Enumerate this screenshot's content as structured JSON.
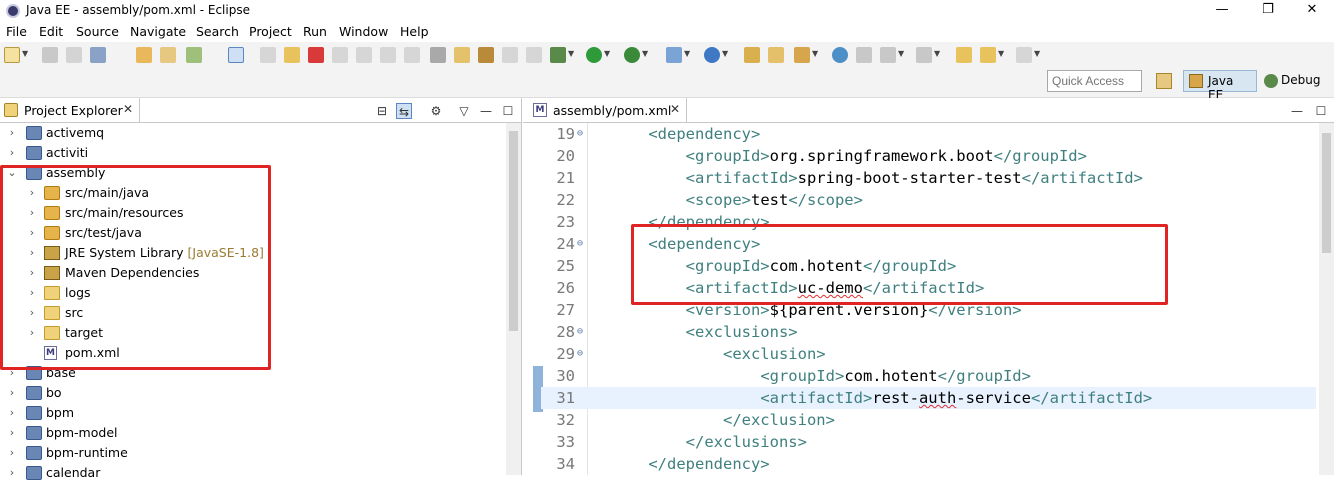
{
  "window": {
    "title": "Java EE - assembly/pom.xml - Eclipse",
    "minimize": "—",
    "restore": "❐",
    "close": "✕"
  },
  "menu": [
    "File",
    "Edit",
    "Source",
    "Navigate",
    "Search",
    "Project",
    "Run",
    "Window",
    "Help"
  ],
  "toolbar": {
    "quick_access_placeholder": "Quick Access",
    "perspectives": [
      {
        "label": "Java EE",
        "active": true
      },
      {
        "label": "Debug",
        "active": false
      }
    ]
  },
  "explorer": {
    "tab_label": "Project Explorer",
    "close_glyph": "✕",
    "items": [
      {
        "label": "activemq",
        "expanded": false,
        "icon": "project-icon"
      },
      {
        "label": "activiti",
        "expanded": false,
        "icon": "project-icon"
      },
      {
        "label": "assembly",
        "expanded": true,
        "icon": "project-icon"
      },
      {
        "label": "src/main/java",
        "expanded": false,
        "icon": "package-folder-icon"
      },
      {
        "label": "src/main/resources",
        "expanded": false,
        "icon": "package-folder-icon"
      },
      {
        "label": "src/test/java",
        "expanded": false,
        "icon": "package-folder-icon"
      },
      {
        "label": "JRE System Library",
        "decoration": "[JavaSE-1.8]",
        "expanded": false,
        "icon": "library-icon"
      },
      {
        "label": "Maven Dependencies",
        "expanded": false,
        "icon": "library-icon"
      },
      {
        "label": "logs",
        "expanded": false,
        "icon": "folder-icon"
      },
      {
        "label": "src",
        "expanded": false,
        "icon": "folder-icon"
      },
      {
        "label": "target",
        "expanded": false,
        "icon": "folder-icon"
      },
      {
        "label": "pom.xml",
        "icon": "xml-file-icon"
      },
      {
        "label": "base",
        "expanded": false,
        "icon": "project-icon"
      },
      {
        "label": "bo",
        "expanded": false,
        "icon": "project-icon"
      },
      {
        "label": "bpm",
        "expanded": false,
        "icon": "project-icon"
      },
      {
        "label": "bpm-model",
        "expanded": false,
        "icon": "project-icon"
      },
      {
        "label": "bpm-runtime",
        "expanded": false,
        "icon": "project-icon"
      },
      {
        "label": "calendar",
        "expanded": false,
        "icon": "project-icon"
      }
    ]
  },
  "editor": {
    "tab_label": "assembly/pom.xml",
    "close_glyph": "✕",
    "lines": [
      {
        "num": "19",
        "fold": "⊖",
        "indent": "    ",
        "parts": [
          [
            "tg",
            "<dependency>"
          ]
        ]
      },
      {
        "num": "20",
        "fold": "",
        "indent": "        ",
        "parts": [
          [
            "tg",
            "<groupId>"
          ],
          [
            "tx",
            "org.springframework.boot"
          ],
          [
            "tg",
            "</groupId>"
          ]
        ]
      },
      {
        "num": "21",
        "fold": "",
        "indent": "        ",
        "parts": [
          [
            "tg",
            "<artifactId>"
          ],
          [
            "tx",
            "spring-boot-starter-test"
          ],
          [
            "tg",
            "</artifactId>"
          ]
        ]
      },
      {
        "num": "22",
        "fold": "",
        "indent": "        ",
        "parts": [
          [
            "tg",
            "<scope>"
          ],
          [
            "tx",
            "test"
          ],
          [
            "tg",
            "</scope>"
          ]
        ]
      },
      {
        "num": "23",
        "fold": "",
        "indent": "    ",
        "parts": [
          [
            "tg",
            "</dependency>"
          ]
        ]
      },
      {
        "num": "24",
        "fold": "⊖",
        "indent": "    ",
        "parts": [
          [
            "tg",
            "<dependency>"
          ]
        ]
      },
      {
        "num": "25",
        "fold": "",
        "indent": "        ",
        "parts": [
          [
            "tg",
            "<groupId>"
          ],
          [
            "tx",
            "com.hotent"
          ],
          [
            "tg",
            "</groupId>"
          ]
        ]
      },
      {
        "num": "26",
        "fold": "",
        "indent": "        ",
        "parts": [
          [
            "tg",
            "<artifactId>"
          ],
          [
            "sq",
            "uc-demo"
          ],
          [
            "tg",
            "</artifactId>"
          ]
        ]
      },
      {
        "num": "27",
        "fold": "",
        "indent": "        ",
        "parts": [
          [
            "tg",
            "<version>"
          ],
          [
            "tx",
            "${parent.version}"
          ],
          [
            "tg",
            "</version>"
          ]
        ]
      },
      {
        "num": "28",
        "fold": "⊖",
        "indent": "        ",
        "parts": [
          [
            "tg",
            "<exclusions>"
          ]
        ]
      },
      {
        "num": "29",
        "fold": "⊖",
        "indent": "            ",
        "parts": [
          [
            "tg",
            "<exclusion>"
          ]
        ]
      },
      {
        "num": "30",
        "fold": "",
        "indent": "                ",
        "parts": [
          [
            "tg",
            "<groupId>"
          ],
          [
            "tx",
            "com.hotent"
          ],
          [
            "tg",
            "</groupId>"
          ]
        ]
      },
      {
        "num": "31",
        "fold": "",
        "indent": "                ",
        "current": true,
        "parts": [
          [
            "tg",
            "<artifactId>"
          ],
          [
            "tx",
            "rest-"
          ],
          [
            "sq",
            "auth"
          ],
          [
            "tx",
            "-service"
          ],
          [
            "tg",
            "</artifactId>"
          ]
        ]
      },
      {
        "num": "32",
        "fold": "",
        "indent": "            ",
        "parts": [
          [
            "tg",
            "</exclusion>"
          ]
        ]
      },
      {
        "num": "33",
        "fold": "",
        "indent": "        ",
        "parts": [
          [
            "tg",
            "</exclusions>"
          ]
        ]
      },
      {
        "num": "34",
        "fold": "",
        "indent": "    ",
        "parts": [
          [
            "tg",
            "</dependency>"
          ]
        ]
      }
    ]
  },
  "colors": {
    "highlight_box": "#e02424",
    "xml_tag": "#3f7f7f",
    "current_line": "#e8f2fe"
  }
}
